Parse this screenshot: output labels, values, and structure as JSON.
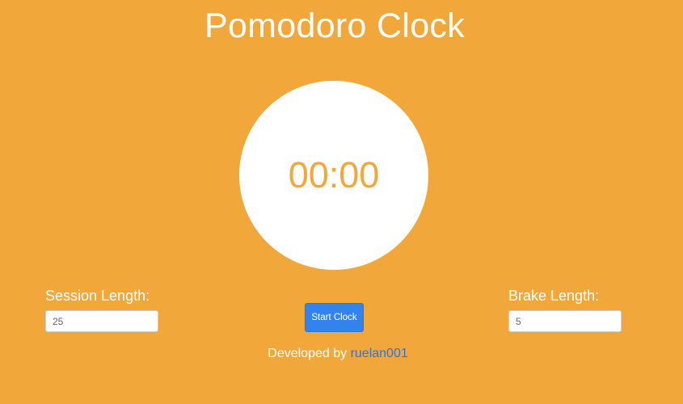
{
  "page": {
    "title": "Pomodoro Clock"
  },
  "clock": {
    "time": "00:00"
  },
  "session": {
    "label": "Session Length:",
    "value": "25"
  },
  "brake": {
    "label": "Brake Length:",
    "value": "5"
  },
  "controls": {
    "start_label": "Start Clock"
  },
  "footer": {
    "text": "Developed by ",
    "link_text": "ruelan001"
  },
  "colors": {
    "background": "#f2a73b",
    "accent": "#3383ee",
    "link": "#2e74df",
    "clock_face": "#ffffff"
  }
}
